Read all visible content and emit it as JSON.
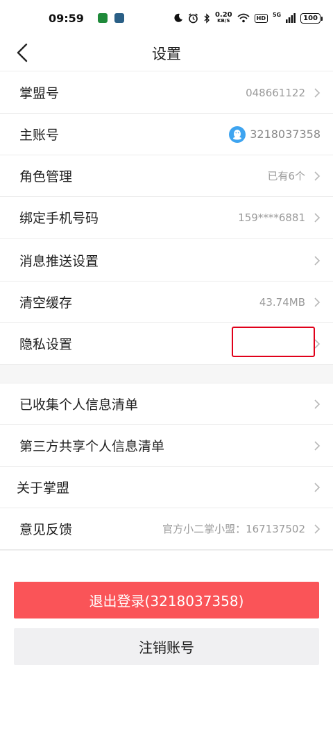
{
  "status_bar": {
    "time": "09:59",
    "net_speed": "0.20",
    "net_unit": "KB/S",
    "hd_label": "HD",
    "signal_label": "5G",
    "battery": "100"
  },
  "nav": {
    "title": "设置"
  },
  "group1": [
    {
      "label": "掌盟号",
      "value": "048661122",
      "chevron": true
    },
    {
      "label": "主账号",
      "value": "3218037358",
      "chevron": false,
      "icon": "qq-penguin-icon"
    },
    {
      "label": "角色管理",
      "value": "已有6个",
      "chevron": true
    },
    {
      "label": "绑定手机号码",
      "value": "159****6881",
      "chevron": true
    }
  ],
  "group2": [
    {
      "label": "消息推送设置",
      "value": "",
      "chevron": true
    },
    {
      "label": "清空缓存",
      "value": "43.74MB",
      "chevron": true
    },
    {
      "label": "隐私设置",
      "value": "",
      "chevron": true
    }
  ],
  "group3": [
    {
      "label": "已收集个人信息清单",
      "value": "",
      "chevron": true
    },
    {
      "label": "第三方共享个人信息清单",
      "value": "",
      "chevron": true
    },
    {
      "label": "关于掌盟",
      "value": "",
      "chevron": true
    },
    {
      "label": "意见反馈",
      "value": "官方小二掌小盟：167137502",
      "chevron": true
    }
  ],
  "buttons": {
    "logout": "退出登录(3218037358)",
    "cancel_account": "注销账号"
  },
  "colors": {
    "accent_red": "#fa5458",
    "highlight_box": "#e0001a",
    "qq_blue": "#3ea4f0"
  }
}
